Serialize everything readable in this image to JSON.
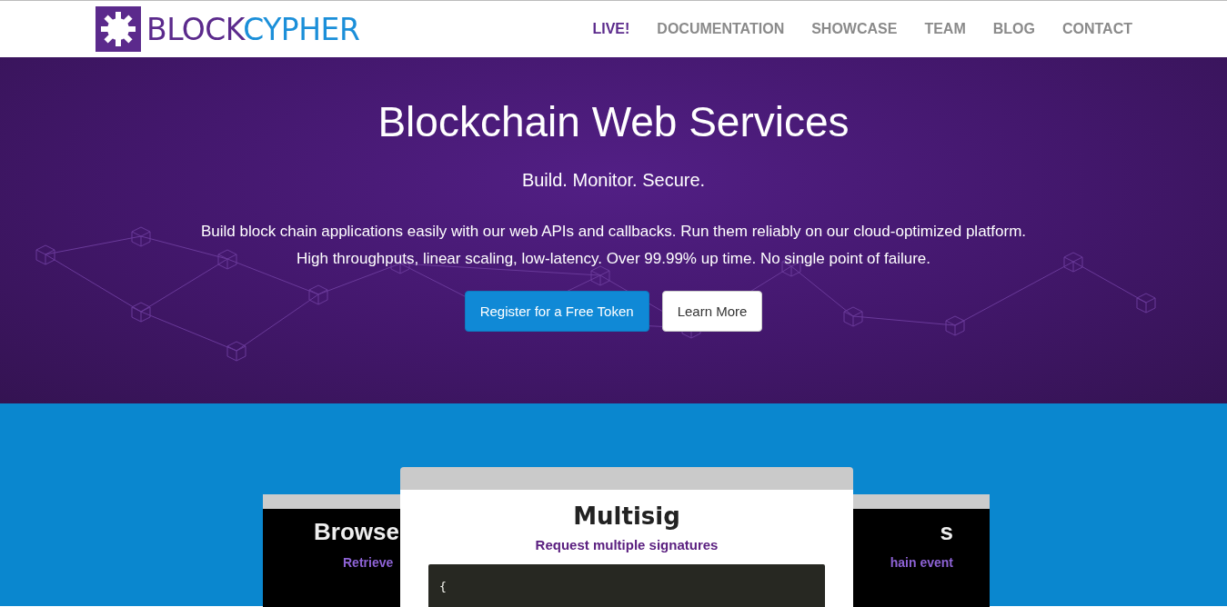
{
  "logo": {
    "part_1": "BLOCK",
    "part_2": "CYPHER"
  },
  "nav": [
    {
      "label": "LIVE!",
      "selected": true
    },
    {
      "label": "DOCUMENTATION",
      "selected": false
    },
    {
      "label": "SHOWCASE",
      "selected": false
    },
    {
      "label": "TEAM",
      "selected": false
    },
    {
      "label": "BLOG",
      "selected": false
    },
    {
      "label": "CONTACT",
      "selected": false
    }
  ],
  "hero": {
    "title": "Blockchain Web Services",
    "tagline": "Build. Monitor. Secure.",
    "description": [
      "Build block chain applications easily with our web APIs and callbacks. Run them reliably on our cloud-optimized platform.",
      "High throughputs, linear scaling, low-latency. Over 99.99% up time. No single point of failure."
    ],
    "buttons": [
      {
        "label": "Register for a Free Token",
        "kind": "primary"
      },
      {
        "label": "Learn More",
        "kind": "secondary"
      }
    ]
  },
  "showcase": {
    "back_cards": [
      {
        "title": "Browse",
        "subtitle": "Retrieve"
      },
      {
        "title": "s",
        "subtitle": "hain event"
      }
    ],
    "card": {
      "title": "Multisig",
      "subtitle": "Request multiple signatures",
      "code": "{"
    }
  }
}
